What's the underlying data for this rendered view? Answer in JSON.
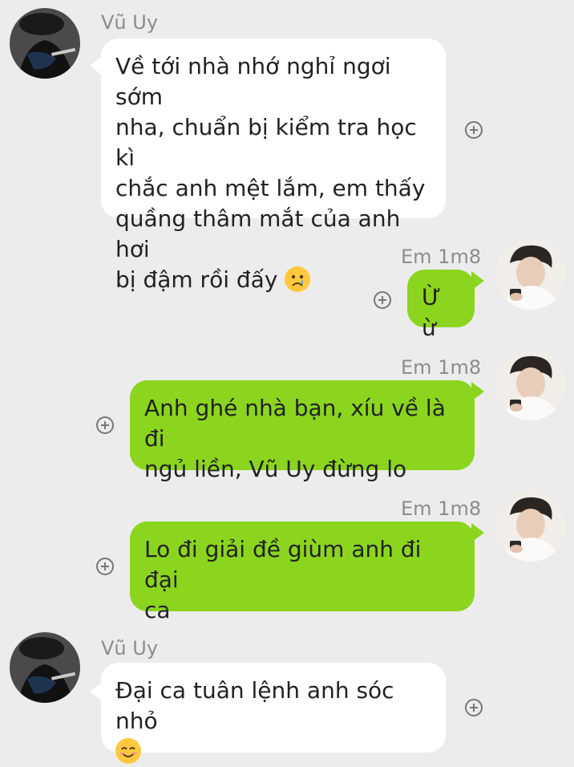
{
  "messages": [
    {
      "sender": "Vũ Uy",
      "direction": "incoming",
      "lines": [
        "Về tới nhà nhớ nghỉ ngơi sớm",
        "nha, chuẩn bị kiểm tra học kì",
        "chắc anh mệt lắm, em thấy",
        "quầng thâm mắt của anh hơi",
        "bị đậm rồi đấy"
      ],
      "trailing_emoji": "crying-face-icon"
    },
    {
      "sender": "Em 1m8",
      "direction": "outgoing",
      "lines": [
        "Ừ ừ"
      ]
    },
    {
      "sender": "Em 1m8",
      "direction": "outgoing",
      "lines": [
        "Anh ghé nhà bạn, xíu về là đi",
        "ngủ liền, Vũ Uy đừng lo"
      ]
    },
    {
      "sender": "Em 1m8",
      "direction": "outgoing",
      "lines": [
        "Lo đi giải đề giùm anh đi đại",
        "ca"
      ]
    },
    {
      "sender": "Vũ Uy",
      "direction": "incoming",
      "lines": [
        "Đại ca tuân lệnh anh sóc nhỏ"
      ],
      "trailing_emoji": "smiling-face-icon"
    }
  ],
  "colors": {
    "incoming_bubble": "#ffffff",
    "outgoing_bubble": "#8bd51f",
    "background": "#ececec"
  }
}
